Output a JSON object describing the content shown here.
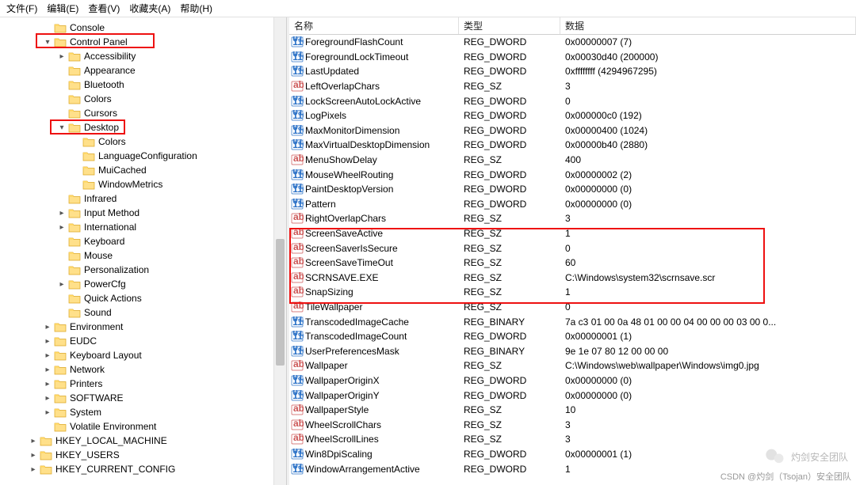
{
  "menu": {
    "file": "文件(F)",
    "edit": "编辑(E)",
    "view": "查看(V)",
    "favorites": "收藏夹(A)",
    "help": "帮助(H)"
  },
  "columns": {
    "name": "名称",
    "type": "类型",
    "data": "数据"
  },
  "tree": [
    {
      "level": 3,
      "exp": "",
      "label": "Console"
    },
    {
      "level": 3,
      "exp": "v",
      "label": "Control Panel"
    },
    {
      "level": 4,
      "exp": ">",
      "label": "Accessibility"
    },
    {
      "level": 4,
      "exp": "",
      "label": "Appearance"
    },
    {
      "level": 4,
      "exp": "",
      "label": "Bluetooth"
    },
    {
      "level": 4,
      "exp": "",
      "label": "Colors"
    },
    {
      "level": 4,
      "exp": "",
      "label": "Cursors"
    },
    {
      "level": 4,
      "exp": "v",
      "label": "Desktop"
    },
    {
      "level": 5,
      "exp": "",
      "label": "Colors"
    },
    {
      "level": 5,
      "exp": "",
      "label": "LanguageConfiguration"
    },
    {
      "level": 5,
      "exp": "",
      "label": "MuiCached"
    },
    {
      "level": 5,
      "exp": "",
      "label": "WindowMetrics"
    },
    {
      "level": 4,
      "exp": "",
      "label": "Infrared"
    },
    {
      "level": 4,
      "exp": ">",
      "label": "Input Method"
    },
    {
      "level": 4,
      "exp": ">",
      "label": "International"
    },
    {
      "level": 4,
      "exp": "",
      "label": "Keyboard"
    },
    {
      "level": 4,
      "exp": "",
      "label": "Mouse"
    },
    {
      "level": 4,
      "exp": "",
      "label": "Personalization"
    },
    {
      "level": 4,
      "exp": ">",
      "label": "PowerCfg"
    },
    {
      "level": 4,
      "exp": "",
      "label": "Quick Actions"
    },
    {
      "level": 4,
      "exp": "",
      "label": "Sound"
    },
    {
      "level": 3,
      "exp": ">",
      "label": "Environment"
    },
    {
      "level": 3,
      "exp": ">",
      "label": "EUDC"
    },
    {
      "level": 3,
      "exp": ">",
      "label": "Keyboard Layout"
    },
    {
      "level": 3,
      "exp": ">",
      "label": "Network"
    },
    {
      "level": 3,
      "exp": ">",
      "label": "Printers"
    },
    {
      "level": 3,
      "exp": ">",
      "label": "SOFTWARE"
    },
    {
      "level": 3,
      "exp": ">",
      "label": "System"
    },
    {
      "level": 3,
      "exp": "",
      "label": "Volatile Environment"
    },
    {
      "level": 2,
      "exp": ">",
      "label": "HKEY_LOCAL_MACHINE"
    },
    {
      "level": 2,
      "exp": ">",
      "label": "HKEY_USERS"
    },
    {
      "level": 2,
      "exp": ">",
      "label": "HKEY_CURRENT_CONFIG"
    }
  ],
  "values": [
    {
      "icon": "dw",
      "name": "ForegroundFlashCount",
      "type": "REG_DWORD",
      "data": "0x00000007 (7)"
    },
    {
      "icon": "dw",
      "name": "ForegroundLockTimeout",
      "type": "REG_DWORD",
      "data": "0x00030d40 (200000)"
    },
    {
      "icon": "dw",
      "name": "LastUpdated",
      "type": "REG_DWORD",
      "data": "0xffffffff (4294967295)"
    },
    {
      "icon": "sz",
      "name": "LeftOverlapChars",
      "type": "REG_SZ",
      "data": "3"
    },
    {
      "icon": "dw",
      "name": "LockScreenAutoLockActive",
      "type": "REG_DWORD",
      "data": "0"
    },
    {
      "icon": "dw",
      "name": "LogPixels",
      "type": "REG_DWORD",
      "data": "0x000000c0 (192)"
    },
    {
      "icon": "dw",
      "name": "MaxMonitorDimension",
      "type": "REG_DWORD",
      "data": "0x00000400 (1024)"
    },
    {
      "icon": "dw",
      "name": "MaxVirtualDesktopDimension",
      "type": "REG_DWORD",
      "data": "0x00000b40 (2880)"
    },
    {
      "icon": "sz",
      "name": "MenuShowDelay",
      "type": "REG_SZ",
      "data": "400"
    },
    {
      "icon": "dw",
      "name": "MouseWheelRouting",
      "type": "REG_DWORD",
      "data": "0x00000002 (2)"
    },
    {
      "icon": "dw",
      "name": "PaintDesktopVersion",
      "type": "REG_DWORD",
      "data": "0x00000000 (0)"
    },
    {
      "icon": "dw",
      "name": "Pattern",
      "type": "REG_DWORD",
      "data": "0x00000000 (0)"
    },
    {
      "icon": "sz",
      "name": "RightOverlapChars",
      "type": "REG_SZ",
      "data": "3"
    },
    {
      "icon": "sz",
      "name": "ScreenSaveActive",
      "type": "REG_SZ",
      "data": "1"
    },
    {
      "icon": "sz",
      "name": "ScreenSaverIsSecure",
      "type": "REG_SZ",
      "data": "0"
    },
    {
      "icon": "sz",
      "name": "ScreenSaveTimeOut",
      "type": "REG_SZ",
      "data": "60"
    },
    {
      "icon": "sz",
      "name": "SCRNSAVE.EXE",
      "type": "REG_SZ",
      "data": "C:\\Windows\\system32\\scrnsave.scr"
    },
    {
      "icon": "sz",
      "name": "SnapSizing",
      "type": "REG_SZ",
      "data": "1"
    },
    {
      "icon": "sz",
      "name": "TileWallpaper",
      "type": "REG_SZ",
      "data": "0"
    },
    {
      "icon": "bin",
      "name": "TranscodedImageCache",
      "type": "REG_BINARY",
      "data": "7a c3 01 00 0a 48 01 00 00 04 00 00 00 03 00 0..."
    },
    {
      "icon": "dw",
      "name": "TranscodedImageCount",
      "type": "REG_DWORD",
      "data": "0x00000001 (1)"
    },
    {
      "icon": "bin",
      "name": "UserPreferencesMask",
      "type": "REG_BINARY",
      "data": "9e 1e 07 80 12 00 00 00"
    },
    {
      "icon": "sz",
      "name": "Wallpaper",
      "type": "REG_SZ",
      "data": "C:\\Windows\\web\\wallpaper\\Windows\\img0.jpg"
    },
    {
      "icon": "dw",
      "name": "WallpaperOriginX",
      "type": "REG_DWORD",
      "data": "0x00000000 (0)"
    },
    {
      "icon": "dw",
      "name": "WallpaperOriginY",
      "type": "REG_DWORD",
      "data": "0x00000000 (0)"
    },
    {
      "icon": "sz",
      "name": "WallpaperStyle",
      "type": "REG_SZ",
      "data": "10"
    },
    {
      "icon": "sz",
      "name": "WheelScrollChars",
      "type": "REG_SZ",
      "data": "3"
    },
    {
      "icon": "sz",
      "name": "WheelScrollLines",
      "type": "REG_SZ",
      "data": "3"
    },
    {
      "icon": "dw",
      "name": "Win8DpiScaling",
      "type": "REG_DWORD",
      "data": "0x00000001 (1)"
    },
    {
      "icon": "dw",
      "name": "WindowArrangementActive",
      "type": "REG_DWORD",
      "data": "1"
    }
  ],
  "watermark": {
    "brand": "灼剑安全团队",
    "credit": "CSDN @灼剑（Tsojan）安全团队"
  }
}
